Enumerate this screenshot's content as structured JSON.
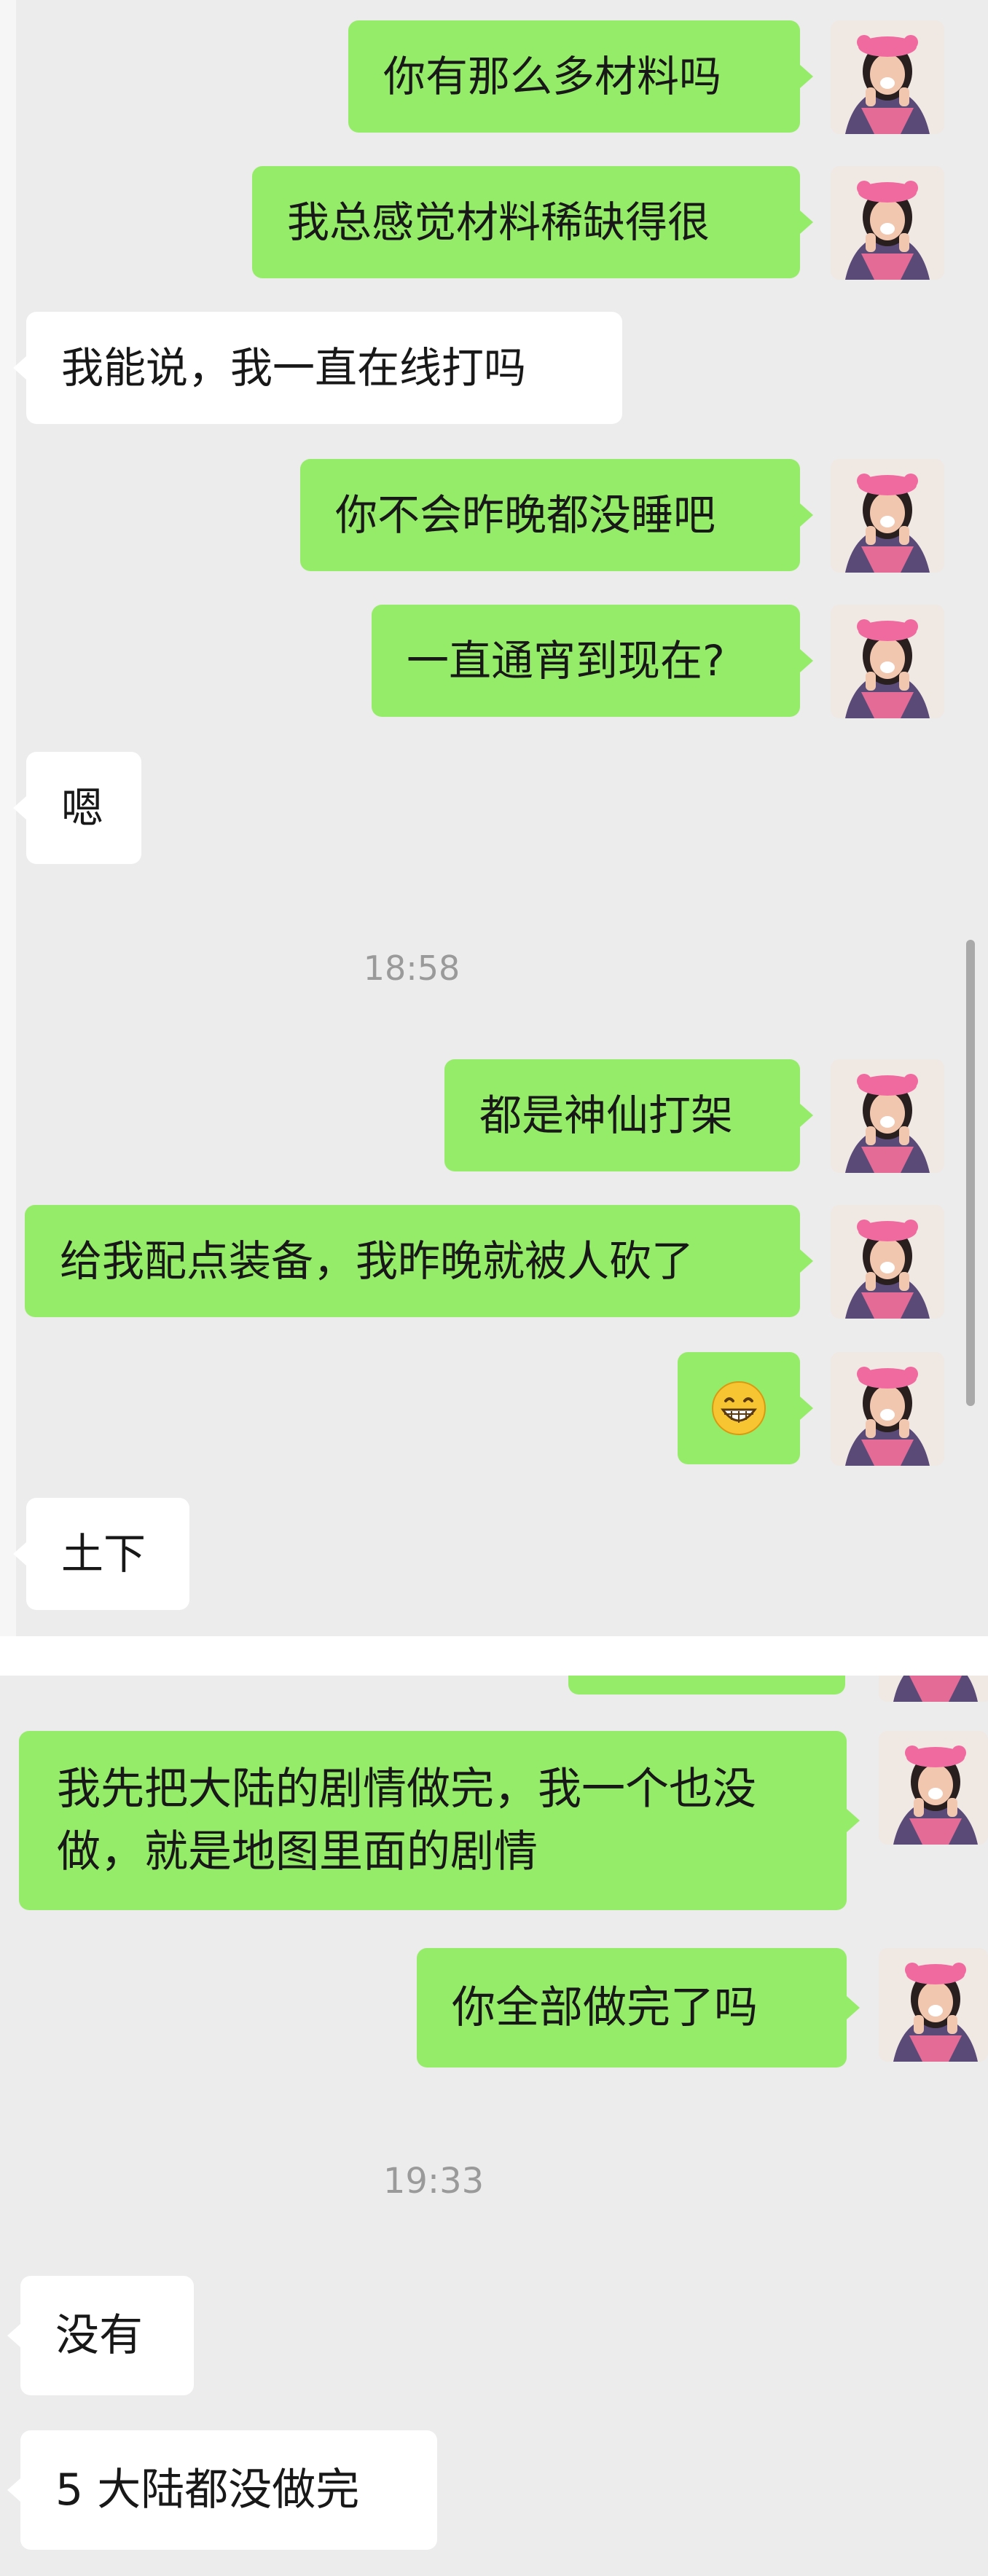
{
  "messages_top": [
    {
      "side": "out",
      "text": "你有那么多材料吗"
    },
    {
      "side": "out",
      "text": "我总感觉材料稀缺得很"
    },
    {
      "side": "in",
      "text": "我能说，我一直在线打吗"
    },
    {
      "side": "out",
      "text": "你不会昨晚都没睡吧"
    },
    {
      "side": "out",
      "text": "一直通宵到现在?"
    },
    {
      "side": "in",
      "text": "嗯"
    },
    {
      "side": "out",
      "text": "都是神仙打架"
    },
    {
      "side": "out",
      "text": "给我配点装备，我昨晚就被人砍了"
    },
    {
      "side": "out",
      "emoji": "grinning-face-icon"
    },
    {
      "side": "in",
      "text": "土下"
    }
  ],
  "timestamps": {
    "first": "18:58",
    "second": "19:33"
  },
  "messages_bottom": [
    {
      "side": "out",
      "text": "我先把大陆的剧情做完，我一个也没做，就是地图里面的剧情"
    },
    {
      "side": "out",
      "text": "你全部做完了吗"
    },
    {
      "side": "in",
      "text": "没有"
    },
    {
      "side": "in",
      "text": "5 大陆都没做完"
    }
  ],
  "colors": {
    "outgoing_bubble": "#95ec69",
    "incoming_bubble": "#ffffff",
    "chat_background": "#ececec",
    "timestamp_text": "#9a9a9a"
  }
}
